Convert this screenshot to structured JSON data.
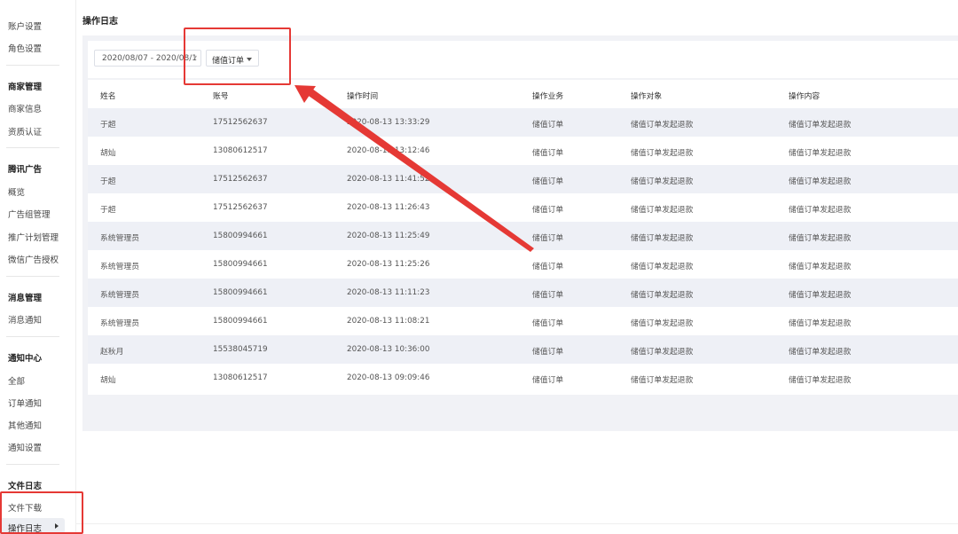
{
  "sidebar": {
    "items": [
      {
        "label": "账户设置",
        "type": "item"
      },
      {
        "label": "角色设置",
        "type": "item"
      },
      {
        "label": "商家管理",
        "type": "head"
      },
      {
        "label": "商家信息",
        "type": "item"
      },
      {
        "label": "资质认证",
        "type": "item"
      },
      {
        "label": "腾讯广告",
        "type": "head"
      },
      {
        "label": "概览",
        "type": "item"
      },
      {
        "label": "广告组管理",
        "type": "item"
      },
      {
        "label": "推广计划管理",
        "type": "item"
      },
      {
        "label": "微信广告授权",
        "type": "item"
      },
      {
        "label": "消息管理",
        "type": "head"
      },
      {
        "label": "消息通知",
        "type": "item"
      },
      {
        "label": "通知中心",
        "type": "head"
      },
      {
        "label": "全部",
        "type": "item"
      },
      {
        "label": "订单通知",
        "type": "item"
      },
      {
        "label": "其他通知",
        "type": "item"
      },
      {
        "label": "通知设置",
        "type": "item"
      },
      {
        "label": "文件日志",
        "type": "head"
      },
      {
        "label": "文件下载",
        "type": "item"
      }
    ],
    "active_label": "操作日志"
  },
  "page": {
    "title": "操作日志"
  },
  "filters": {
    "date_range": "2020/08/07 - 2020/08/1",
    "type_select": "储值订单"
  },
  "table": {
    "headers": [
      "姓名",
      "账号",
      "操作时间",
      "操作业务",
      "操作对象",
      "操作内容"
    ],
    "rows": [
      [
        "于超",
        "17512562637",
        "2020-08-13 13:33:29",
        "储值订单",
        "储值订单发起退款",
        "储值订单发起退款"
      ],
      [
        "胡灿",
        "13080612517",
        "2020-08-13 13:12:46",
        "储值订单",
        "储值订单发起退款",
        "储值订单发起退款"
      ],
      [
        "于超",
        "17512562637",
        "2020-08-13 11:41:52",
        "储值订单",
        "储值订单发起退款",
        "储值订单发起退款"
      ],
      [
        "于超",
        "17512562637",
        "2020-08-13 11:26:43",
        "储值订单",
        "储值订单发起退款",
        "储值订单发起退款"
      ],
      [
        "系统管理员",
        "15800994661",
        "2020-08-13 11:25:49",
        "储值订单",
        "储值订单发起退款",
        "储值订单发起退款"
      ],
      [
        "系统管理员",
        "15800994661",
        "2020-08-13 11:25:26",
        "储值订单",
        "储值订单发起退款",
        "储值订单发起退款"
      ],
      [
        "系统管理员",
        "15800994661",
        "2020-08-13 11:11:23",
        "储值订单",
        "储值订单发起退款",
        "储值订单发起退款"
      ],
      [
        "系统管理员",
        "15800994661",
        "2020-08-13 11:08:21",
        "储值订单",
        "储值订单发起退款",
        "储值订单发起退款"
      ],
      [
        "赵秋月",
        "15538045719",
        "2020-08-13 10:36:00",
        "储值订单",
        "储值订单发起退款",
        "储值订单发起退款"
      ],
      [
        "胡灿",
        "13080612517",
        "2020-08-13 09:09:46",
        "储值订单",
        "储值订单发起退款",
        "储值订单发起退款"
      ]
    ]
  },
  "annotations": {
    "color": "#e53935"
  },
  "colors": {
    "row_alt": "#eef0f6",
    "panel": "#f1f2f6"
  }
}
